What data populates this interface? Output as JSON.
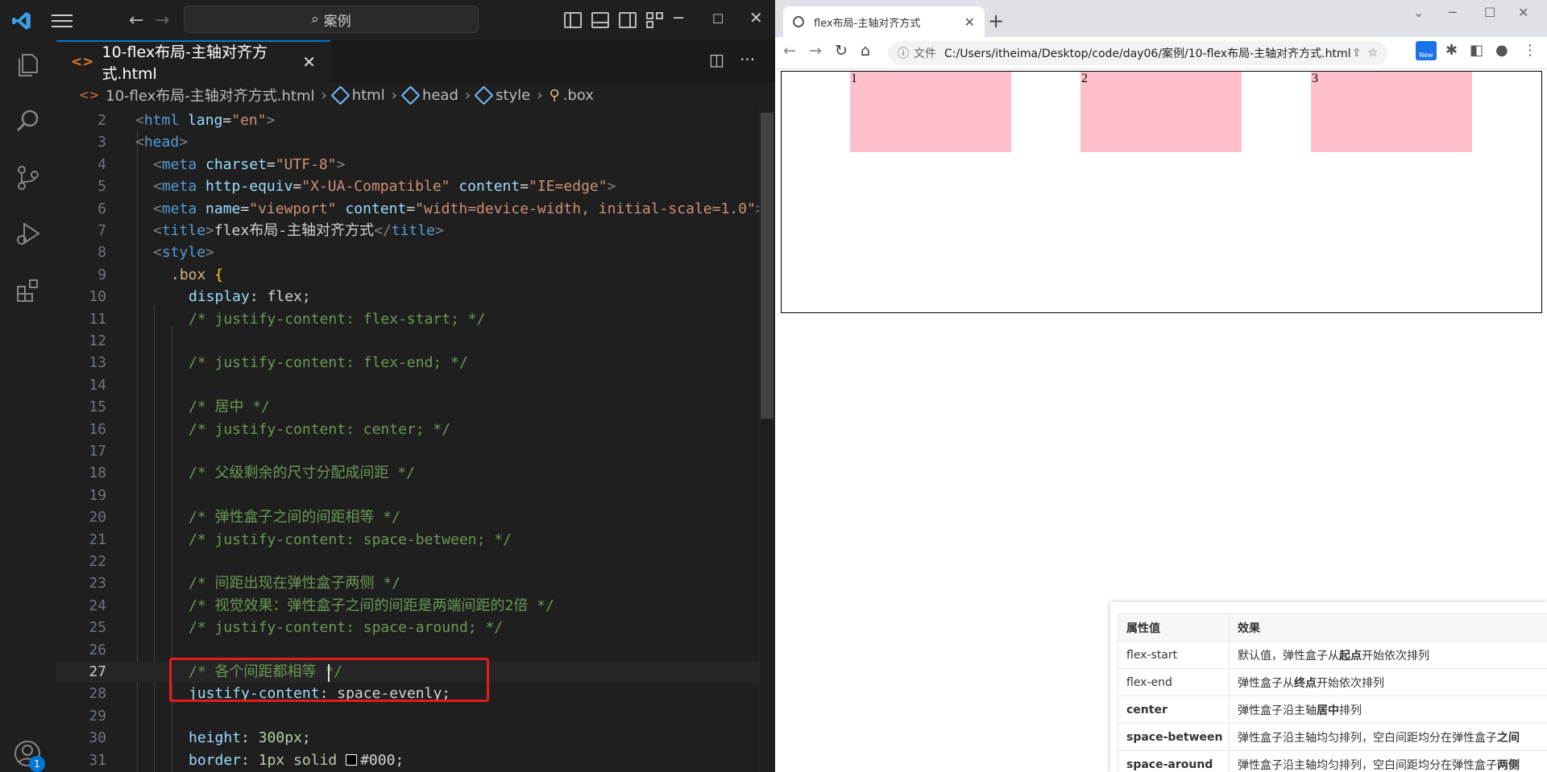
{
  "vscode": {
    "search_text": "案例",
    "tab_label": "10-flex布局-主轴对齐方式.html",
    "tab_tag": "<>",
    "breadcrumb": [
      "10-flex布局-主轴对齐方式.html",
      "html",
      "head",
      "style",
      ".box"
    ],
    "account_badge": "1",
    "lines": [
      {
        "n": "2"
      },
      {
        "n": "3"
      },
      {
        "n": "4"
      },
      {
        "n": "5"
      },
      {
        "n": "6"
      },
      {
        "n": "7"
      },
      {
        "n": "8"
      },
      {
        "n": "9"
      },
      {
        "n": "10"
      },
      {
        "n": "11"
      },
      {
        "n": "12"
      },
      {
        "n": "13"
      },
      {
        "n": "14"
      },
      {
        "n": "15"
      },
      {
        "n": "16"
      },
      {
        "n": "17"
      },
      {
        "n": "18"
      },
      {
        "n": "19"
      },
      {
        "n": "20"
      },
      {
        "n": "21"
      },
      {
        "n": "22"
      },
      {
        "n": "23"
      },
      {
        "n": "24"
      },
      {
        "n": "25"
      },
      {
        "n": "26"
      },
      {
        "n": "27"
      },
      {
        "n": "28"
      },
      {
        "n": "29"
      },
      {
        "n": "30"
      },
      {
        "n": "31"
      }
    ],
    "code": {
      "l2": [
        "<",
        "html",
        " ",
        "lang",
        "=",
        "\"en\"",
        ">"
      ],
      "l3": [
        "<",
        "head",
        ">"
      ],
      "l4": [
        "<",
        "meta",
        " ",
        "charset",
        "=",
        "\"UTF-8\"",
        ">"
      ],
      "l5": [
        "<",
        "meta",
        " ",
        "http-equiv",
        "=",
        "\"X-UA-Compatible\"",
        " ",
        "content",
        "=",
        "\"IE=edge\"",
        ">"
      ],
      "l6": [
        "<",
        "meta",
        " ",
        "name",
        "=",
        "\"viewport\"",
        " ",
        "content",
        "=",
        "\"width=device-width, initial-scale=1.0\"",
        ">"
      ],
      "l7": [
        "<",
        "title",
        ">",
        "flex布局-主轴对齐方式",
        "</",
        "title",
        ">"
      ],
      "l8": [
        "<",
        "style",
        ">"
      ],
      "l9": [
        ".box",
        " ",
        "{"
      ],
      "l10": [
        "display",
        ": ",
        "flex",
        ";"
      ],
      "l11": "/* justify-content: flex-start; */",
      "l13": "/* justify-content: flex-end; */",
      "l15": "/* 居中 */",
      "l16": "/* justify-content: center; */",
      "l18": "/* 父级剩余的尺寸分配成间距 */",
      "l20": "/* 弹性盒子之间的间距相等 */",
      "l21": "/* justify-content: space-between; */",
      "l23": "/* 间距出现在弹性盒子两侧 */",
      "l24": "/* 视觉效果：弹性盒子之间的间距是两端间距的2倍 */",
      "l25": "/* justify-content: space-around; */",
      "l27": "/* 各个间距都相等 */",
      "l28": [
        "justify-content",
        ": ",
        "space-evenly",
        ";"
      ],
      "l30": [
        "height",
        ": ",
        "300px",
        ";"
      ],
      "l31": [
        "border",
        ": ",
        "1px solid ",
        "#000",
        ";"
      ]
    }
  },
  "browser": {
    "tab_title": "flex布局-主轴对齐方式",
    "url_label": "文件",
    "url": "C:/Users/itheima/Desktop/code/day06/案例/10-flex布局-主轴对齐方式.html",
    "new_badge": "New",
    "items": [
      "1",
      "2",
      "3"
    ],
    "item_color": "#ffc0cb"
  },
  "reference": {
    "headers": [
      "属性值",
      "效果"
    ],
    "rows": [
      {
        "value": "flex-start",
        "pre": "默认值，弹性盒子从",
        "bold": "起点",
        "post": "开始依次排列"
      },
      {
        "value": "flex-end",
        "pre": "弹性盒子从",
        "bold": "终点",
        "post": "开始依次排列"
      },
      {
        "value": "center",
        "pre": "弹性盒子沿主轴",
        "bold": "居中",
        "post": "排列"
      },
      {
        "value": "space-between",
        "pre": "弹性盒子沿主轴均匀排列，空白间距均分在弹性盒子",
        "bold": "之间",
        "post": ""
      },
      {
        "value": "space-around",
        "pre": "弹性盒子沿主轴均匀排列，空白间距均分在弹性盒子",
        "bold": "两侧",
        "post": ""
      }
    ]
  }
}
